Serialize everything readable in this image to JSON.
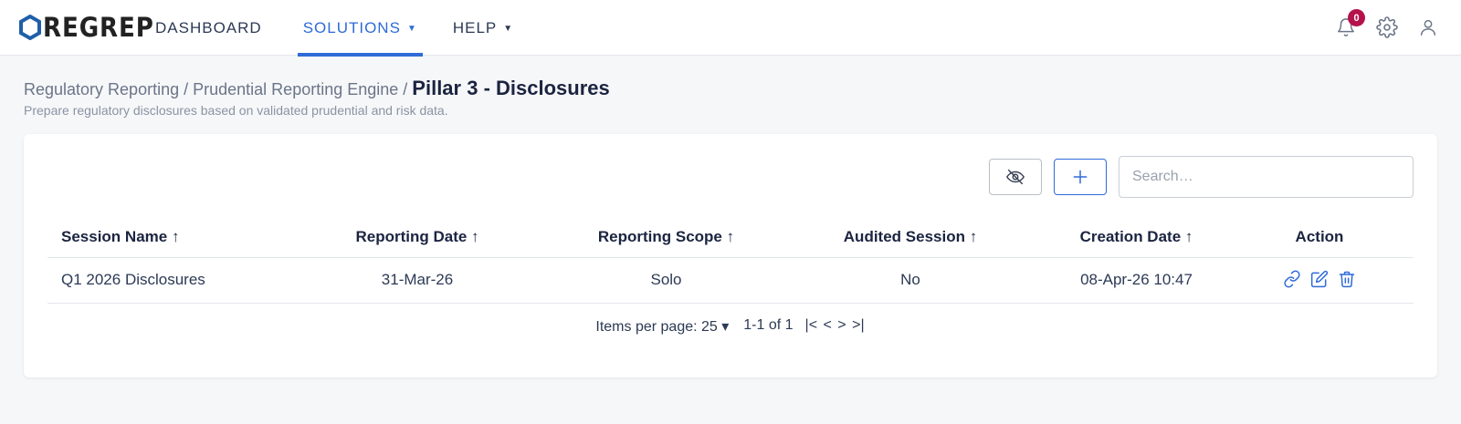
{
  "brand": {
    "name": "REGREP",
    "accent": "#2f6bd8",
    "logo_color": "#1f5fa8"
  },
  "nav": {
    "dashboard": "DASHBOARD",
    "solutions": "SOLUTIONS",
    "help": "HELP"
  },
  "header_icons": {
    "notifications": {
      "icon": "bell-icon",
      "count": "0"
    },
    "settings": {
      "icon": "gear-icon"
    },
    "user": {
      "icon": "user-icon"
    }
  },
  "breadcrumb": {
    "items": [
      "Regulatory Reporting",
      "Prudential Reporting Engine"
    ],
    "separator": "/",
    "current": "Pillar 3 - Disclosures"
  },
  "subtitle": "Prepare regulatory disclosures based on validated prudential and risk data.",
  "toolbar": {
    "hide_icon": "eye-off-icon",
    "add_icon": "plus-icon",
    "search_placeholder": "Search…"
  },
  "table": {
    "columns": [
      "Session Name ↑",
      "Reporting Date ↑",
      "Reporting Scope ↑",
      "Audited Session ↑",
      "Creation Date ↑",
      "Action"
    ],
    "rows": [
      [
        "Q1 2026 Disclosures",
        "31-Mar-26",
        "Solo",
        "No",
        "08-Apr-26 10:47"
      ]
    ],
    "row_actions": [
      "link-icon",
      "edit-icon",
      "trash-icon"
    ]
  },
  "pagination": {
    "items_per_page_label": "Items per page: 25 ▾",
    "range": "1-1 of 1",
    "first": "|<",
    "prev": "<",
    "next": ">",
    "last": ">|"
  }
}
